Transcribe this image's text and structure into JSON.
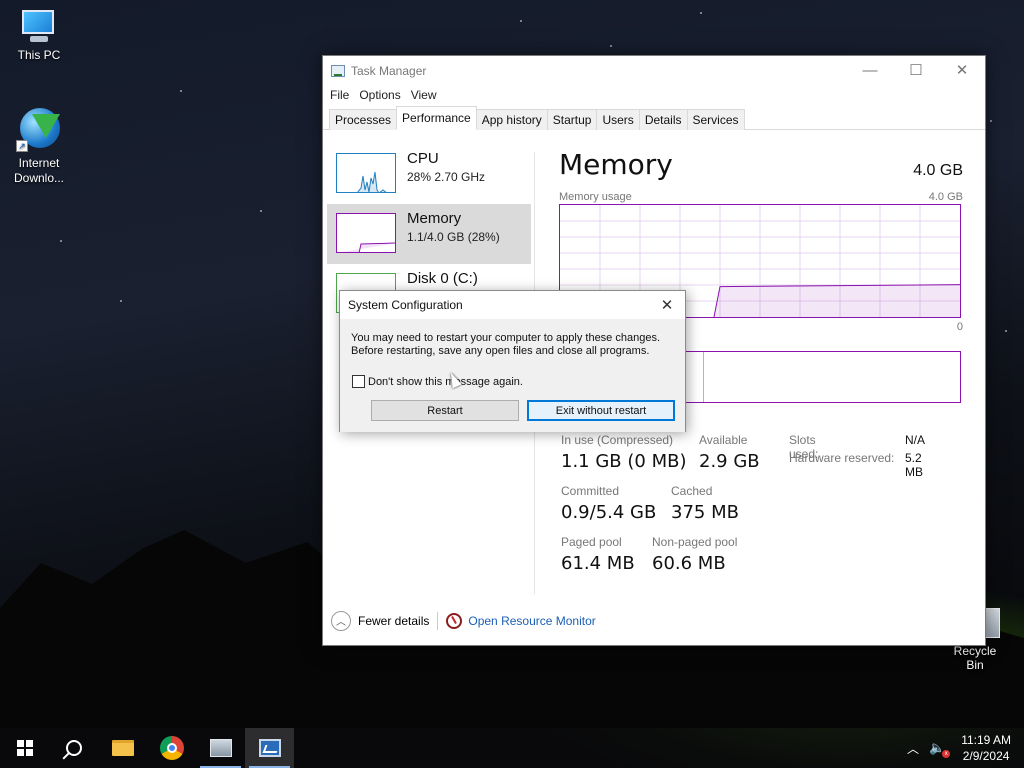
{
  "desktop": {
    "icons": [
      {
        "label": "This PC"
      },
      {
        "label": "Internet\nDownlo..."
      }
    ],
    "recycle_bin": {
      "label": "Recycle Bin"
    }
  },
  "task_manager": {
    "title": "Task Manager",
    "menu": [
      "File",
      "Options",
      "View"
    ],
    "tabs": [
      "Processes",
      "Performance",
      "App history",
      "Startup",
      "Users",
      "Details",
      "Services"
    ],
    "active_tab": "Performance",
    "resources": [
      {
        "name": "CPU",
        "detail": "28%  2.70 GHz",
        "color": "#1f7fbf"
      },
      {
        "name": "Memory",
        "detail": "1.1/4.0 GB (28%)",
        "color": "#8b12ae"
      },
      {
        "name": "Disk 0 (C:)",
        "detail": "",
        "color": "#4da64d"
      }
    ],
    "memory": {
      "title": "Memory",
      "total": "4.0 GB",
      "usage_label": "Memory usage",
      "usage_max": "4.0 GB",
      "usage_min": "0",
      "usage_fraction": 0.28,
      "composition_used_fraction": 0.36,
      "stats": {
        "in_use_label": "In use (Compressed)",
        "in_use_value": "1.1 GB (0 MB)",
        "available_label": "Available",
        "available_value": "2.9 GB",
        "committed_label": "Committed",
        "committed_value": "0.9/5.4 GB",
        "cached_label": "Cached",
        "cached_value": "375 MB",
        "paged_label": "Paged pool",
        "paged_value": "61.4 MB",
        "nonpaged_label": "Non-paged pool",
        "nonpaged_value": "60.6 MB",
        "slots_label": "Slots used:",
        "slots_value": "N/A",
        "hw_label": "Hardware reserved:",
        "hw_value": "5.2 MB"
      }
    },
    "footer": {
      "fewer_details": "Fewer details",
      "resource_monitor": "Open Resource Monitor"
    }
  },
  "dialog": {
    "title": "System Configuration",
    "message_line1": "You may need to restart your computer to apply these changes.",
    "message_line2": "Before restarting, save any open files and close all programs.",
    "checkbox_label": "Don't show this message again.",
    "checkbox_checked": false,
    "restart_label": "Restart",
    "exit_label": "Exit without restart"
  },
  "taskbar": {
    "time": "11:19 AM",
    "date": "2/9/2024"
  },
  "colors": {
    "memory_accent": "#8b12ae",
    "link": "#1a5fb4",
    "primary_button_border": "#0078d7"
  }
}
